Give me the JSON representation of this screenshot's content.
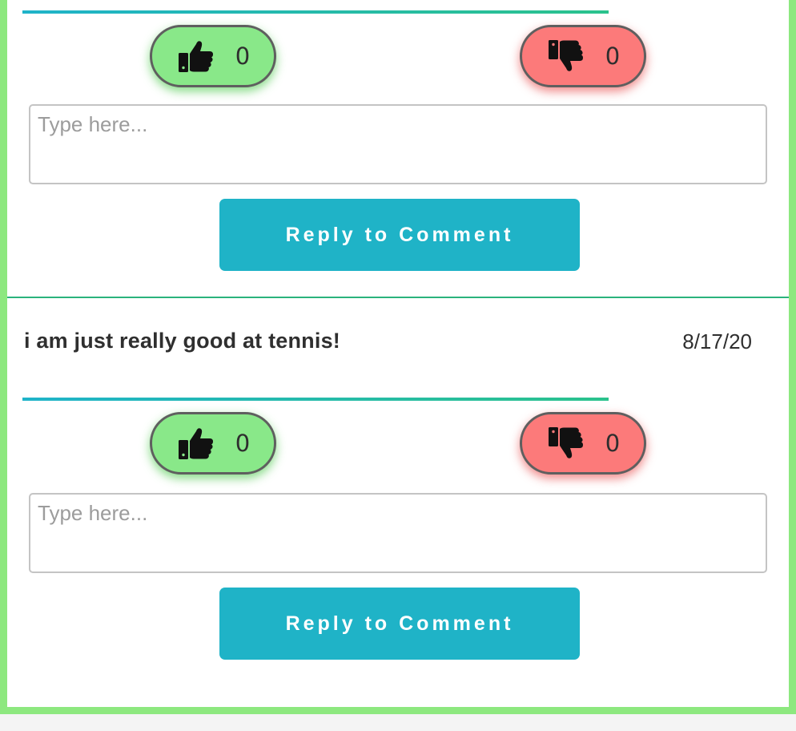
{
  "comments": [
    {
      "text": "",
      "date": "",
      "likes": "0",
      "dislikes": "0",
      "reply_placeholder": "Type here...",
      "reply_button_label": "Reply to Comment"
    },
    {
      "text": "i am just really good at tennis!",
      "date": "8/17/20",
      "likes": "0",
      "dislikes": "0",
      "reply_placeholder": "Type here...",
      "reply_button_label": "Reply to Comment"
    }
  ],
  "icons": {
    "like": "thumbs-up-icon",
    "dislike": "thumbs-down-icon"
  },
  "colors": {
    "frame_border": "#8de87f",
    "like_bg": "#89e889",
    "dislike_bg": "#fc7a7a",
    "button_bg": "#1fb3c7",
    "divider": "#2bb37c"
  }
}
